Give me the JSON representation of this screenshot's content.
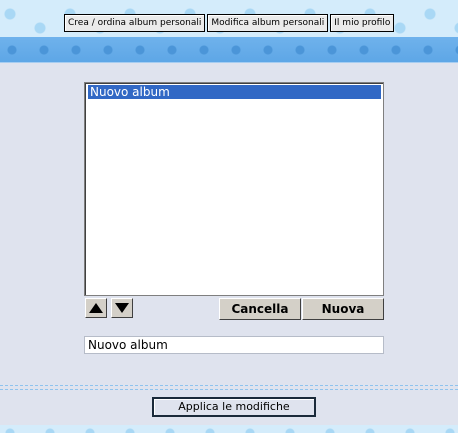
{
  "header": {
    "nav": [
      {
        "label": "Crea / ordina album personali"
      },
      {
        "label": "Modifica album personali"
      },
      {
        "label": "Il mio profilo"
      }
    ]
  },
  "album_list": {
    "items": [
      {
        "label": "Nuovo album",
        "selected": true
      }
    ]
  },
  "controls": {
    "move_up_icon": "triangle-up",
    "move_down_icon": "triangle-down",
    "delete_label": "Cancella",
    "new_label": "Nuova"
  },
  "name_field": {
    "value": "Nuovo album"
  },
  "footer": {
    "apply_label": "Applica le modifiche"
  },
  "colors": {
    "selection": "#3168c5",
    "band": "#6fb2ec",
    "page_background": "#dfe3ee"
  }
}
